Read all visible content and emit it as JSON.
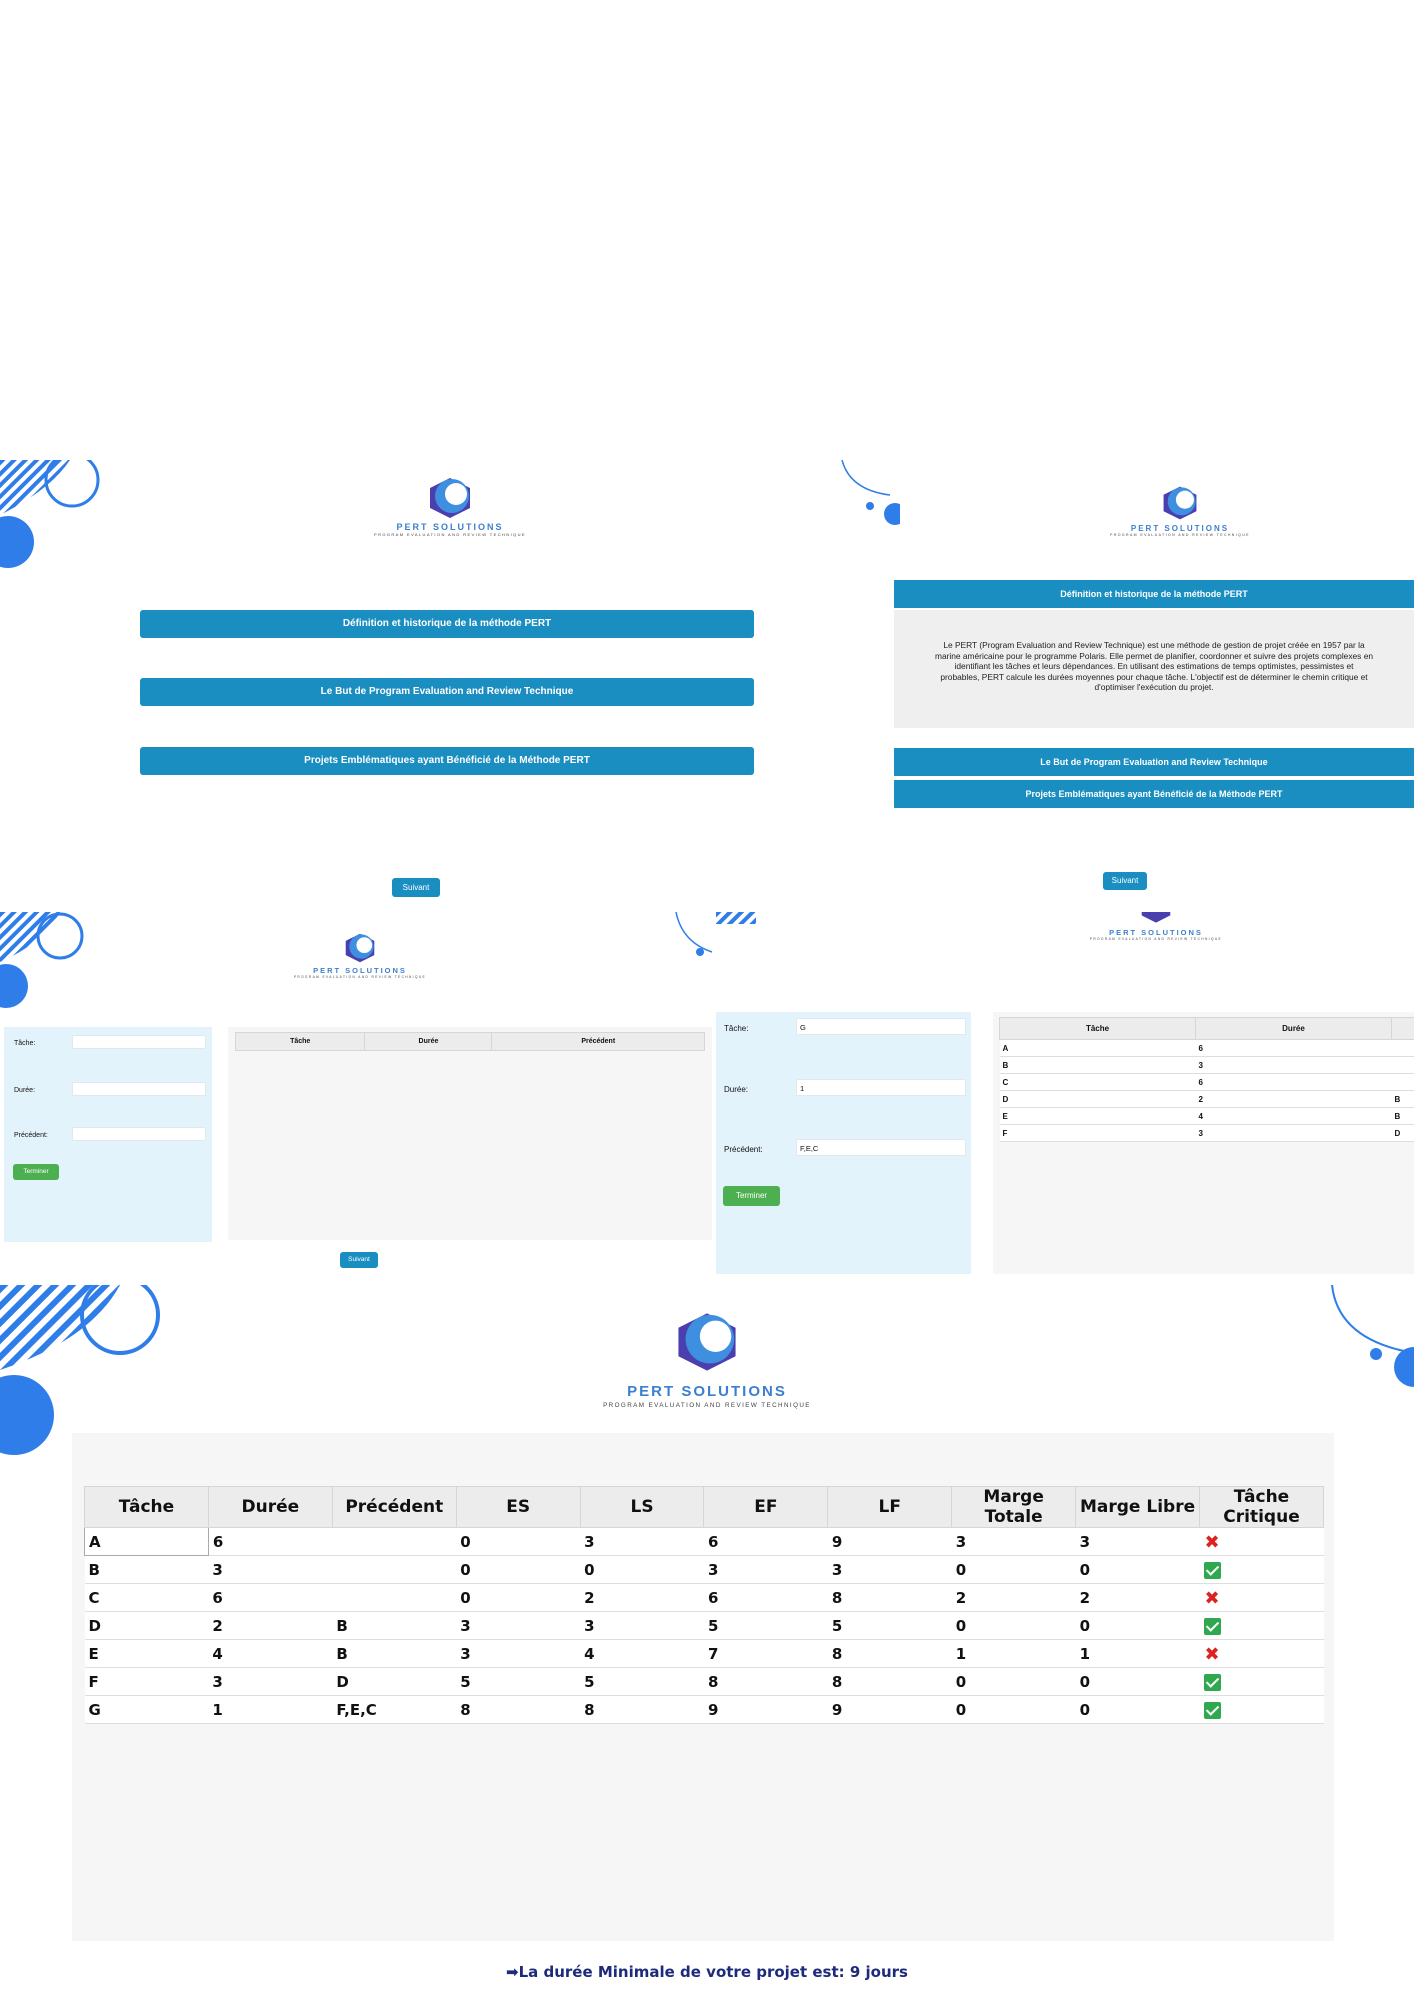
{
  "brand": {
    "title": "PERT SOLUTIONS",
    "subtitle": "PROGRAM EVALUATION AND REVIEW TECHNIQUE"
  },
  "menu": {
    "item1": "Définition et historique de la méthode PERT",
    "item2": "Le But de Program Evaluation and Review Technique",
    "item3": "Projets Emblématiques ayant Bénéficié de la Méthode PERT"
  },
  "definition_text": "Le PERT (Program Evaluation and Review Technique) est une méthode de gestion de projet créée en 1957 par la marine américaine  pour le programme Polaris. Elle permet de planifier, coordonner et suivre des projets complexes en identifiant les tâches et leurs dépendances. En utilisant des estimations de temps optimistes, pessimistes et probables, PERT calcule les durées moyennes pour chaque tâche. L'objectif est de déterminer le chemin critique et d'optimiser l'exécution du projet.",
  "buttons": {
    "next": "Suivant",
    "finish": "Terminer"
  },
  "form": {
    "task_label": "Tâche:",
    "duration_label": "Durée:",
    "previous_label": "Précédent:",
    "filled_task": "G",
    "filled_duration": "1",
    "filled_previous": "F,E,C"
  },
  "input_table": {
    "headers": [
      "Tâche",
      "Durée",
      "Précédent"
    ]
  },
  "partial_table": {
    "headers": [
      "Tâche",
      "Durée"
    ],
    "rows": [
      [
        "A",
        "6",
        ""
      ],
      [
        "B",
        "3",
        ""
      ],
      [
        "C",
        "6",
        ""
      ],
      [
        "D",
        "2",
        "B"
      ],
      [
        "E",
        "4",
        "B"
      ],
      [
        "F",
        "3",
        "D"
      ]
    ]
  },
  "result_table": {
    "headers": [
      "Tâche",
      "Durée",
      "Précédent",
      "ES",
      "LS",
      "EF",
      "LF",
      "Marge Totale",
      "Marge Libre",
      "Tâche Critique"
    ],
    "rows": [
      {
        "task": "A",
        "duration": "6",
        "previous": "",
        "es": "0",
        "ls": "3",
        "ef": "6",
        "lf": "9",
        "total": "3",
        "free": "3",
        "critical": false
      },
      {
        "task": "B",
        "duration": "3",
        "previous": "",
        "es": "0",
        "ls": "0",
        "ef": "3",
        "lf": "3",
        "total": "0",
        "free": "0",
        "critical": true
      },
      {
        "task": "C",
        "duration": "6",
        "previous": "",
        "es": "0",
        "ls": "2",
        "ef": "6",
        "lf": "8",
        "total": "2",
        "free": "2",
        "critical": false
      },
      {
        "task": "D",
        "duration": "2",
        "previous": "B",
        "es": "3",
        "ls": "3",
        "ef": "5",
        "lf": "5",
        "total": "0",
        "free": "0",
        "critical": true
      },
      {
        "task": "E",
        "duration": "4",
        "previous": "B",
        "es": "3",
        "ls": "4",
        "ef": "7",
        "lf": "8",
        "total": "1",
        "free": "1",
        "critical": false
      },
      {
        "task": "F",
        "duration": "3",
        "previous": "D",
        "es": "5",
        "ls": "5",
        "ef": "8",
        "lf": "8",
        "total": "0",
        "free": "0",
        "critical": true
      },
      {
        "task": "G",
        "duration": "1",
        "previous": "F,E,C",
        "es": "8",
        "ls": "8",
        "ef": "9",
        "lf": "9",
        "total": "0",
        "free": "0",
        "critical": true
      }
    ]
  },
  "result_message": "➡La durée Minimale de votre projet est: 9 jours",
  "colors": {
    "primary_blue": "#1a8ec0",
    "green": "#4caf50",
    "form_bg": "#e3f3fc",
    "accent_deco": "#2f7de9",
    "message": "#1e2a7a"
  }
}
